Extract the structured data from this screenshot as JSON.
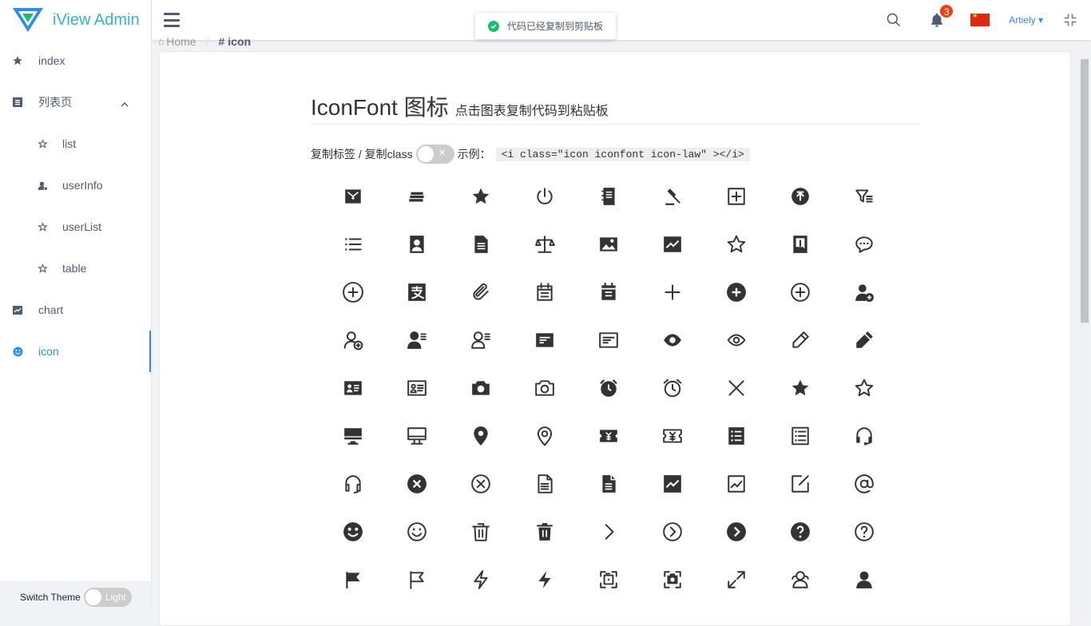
{
  "app": {
    "title": "iView Admin"
  },
  "sidebar": {
    "items": [
      {
        "label": "index",
        "icon": "star-icon"
      },
      {
        "label": "列表页",
        "icon": "list-icon"
      },
      {
        "label": "list",
        "icon": "star-outline-icon"
      },
      {
        "label": "userInfo",
        "icon": "user-icon"
      },
      {
        "label": "userList",
        "icon": "star-outline-icon"
      },
      {
        "label": "table",
        "icon": "star-outline-icon"
      },
      {
        "label": "chart",
        "icon": "chart-icon"
      },
      {
        "label": "icon",
        "icon": "smile-icon"
      }
    ],
    "theme_label": "Switch Theme",
    "theme_value": "Light"
  },
  "header": {
    "notification_count": "3",
    "user_name": "Artiely",
    "accent_color": "#2d8cf0"
  },
  "toast": {
    "message": "代码已经复制到剪贴板"
  },
  "breadcrumb": {
    "home": "Home",
    "current": "icon",
    "current_prefix": "#"
  },
  "main": {
    "title": "IconFont 图标",
    "subtitle": "点击图表复制代码到粘贴板",
    "toggle_label": "复制标签 / 复制class",
    "example_label": "示例：",
    "example_code": "<i class=\"icon iconfont icon-law\" ></i>"
  },
  "icons": [
    "law-icon",
    "books-icon",
    "star-filled-icon",
    "power-icon",
    "notebook-icon",
    "gavel-icon",
    "add-square-icon",
    "upload-circle-icon",
    "filter-list-icon",
    "list-icon",
    "portrait-icon",
    "document-filled-icon",
    "balance-icon",
    "image-icon",
    "chart-filled-icon",
    "star-outline-icon",
    "contract-icon",
    "chat-icon",
    "add-circle-outline-icon",
    "alipay-icon",
    "paperclip-icon",
    "calendar-outline-icon",
    "calendar-filled-icon",
    "plus-icon",
    "add-circle-filled-icon",
    "add-circle-icon",
    "user-add-filled-icon",
    "user-add-outline-icon",
    "user-list-filled-icon",
    "user-list-outline-icon",
    "card-filled-icon",
    "card-outline-icon",
    "eye-filled-icon",
    "eye-outline-icon",
    "pencil-outline-icon",
    "pencil-filled-icon",
    "id-card-filled-icon",
    "id-card-outline-icon",
    "camera-filled-icon",
    "camera-outline-icon",
    "alarm-filled-icon",
    "alarm-outline-icon",
    "close-icon",
    "star-solid-icon",
    "star-line-icon",
    "monitor-filled-icon",
    "monitor-outline-icon",
    "location-filled-icon",
    "location-outline-icon",
    "ticket-filled-icon",
    "ticket-outline-icon",
    "list-box-filled-icon",
    "list-box-outline-icon",
    "headset-filled-icon",
    "headset-outline-icon",
    "close-circle-filled-icon",
    "close-circle-outline-icon",
    "file-outline-icon",
    "file-filled-icon",
    "trend-filled-icon",
    "trend-outline-icon",
    "edit-icon",
    "at-icon",
    "smile-filled-icon",
    "smile-outline-icon",
    "trash-outline-icon",
    "trash-filled-icon",
    "chevron-right-icon",
    "chevron-circle-outline-icon",
    "chevron-circle-filled-icon",
    "question-filled-icon",
    "question-outline-icon",
    "flag-filled-icon",
    "flag-outline-icon",
    "bolt-outline-icon",
    "bolt-filled-icon",
    "screenshot-outline-icon",
    "screenshot-filled-icon",
    "expand-icon",
    "user-outline-icon",
    "user-filled-icon"
  ]
}
